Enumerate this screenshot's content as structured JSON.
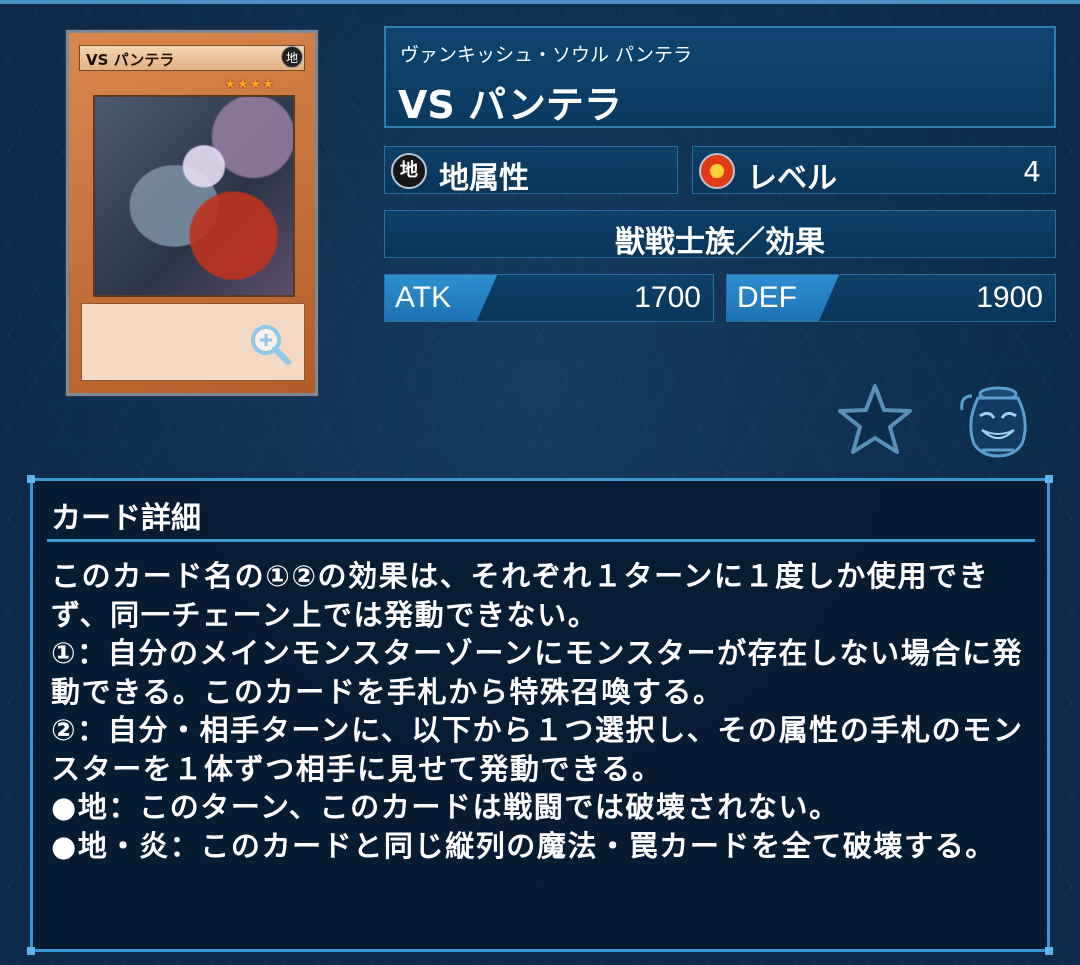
{
  "card": {
    "image_name": "VS パンテラ",
    "image_attribute_glyph": "地",
    "image_stars": "★★★★"
  },
  "header": {
    "ruby": "ヴァンキッシュ・ソウル パンテラ",
    "name": "VS パンテラ"
  },
  "attribute": {
    "label": "地属性",
    "icon": "earth-attribute-icon",
    "glyph": "地"
  },
  "level": {
    "label": "レベル",
    "value": "4",
    "icon": "level-star-icon"
  },
  "type": {
    "label": "獣戦士族／効果"
  },
  "atk": {
    "label": "ATK",
    "value": "1700"
  },
  "def": {
    "label": "DEF",
    "value": "1900"
  },
  "icons": {
    "favorite": "star-icon",
    "pot": "pot-of-greed-icon",
    "zoom": "zoom-icon"
  },
  "colors": {
    "accent": "#3b97d4",
    "panel": "#0b3a60",
    "tag": "#2e8fd0"
  },
  "detail": {
    "title": "カード詳細",
    "text": "このカード名の①②の効果は、それぞれ１ターンに１度しか使用できず、同一チェーン上では発動できない。\n①：自分のメインモンスターゾーンにモンスターが存在しない場合に発動できる。このカードを手札から特殊召喚する。\n②：自分・相手ターンに、以下から１つ選択し、その属性の手札のモンスターを１体ずつ相手に見せて発動できる。\n●地：このターン、このカードは戦闘では破壊されない。\n●地・炎：このカードと同じ縦列の魔法・罠カードを全て破壊する。"
  }
}
